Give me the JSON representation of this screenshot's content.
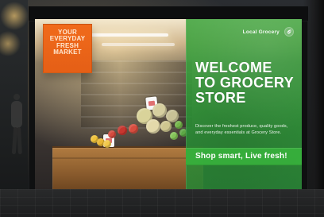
{
  "orange_poster": {
    "text": "YOUR\nEVERYDAY\nFRESH\nMARKET",
    "color": "#f06a1b"
  },
  "green_panel": {
    "brand": "Local Grocery",
    "headline": "WELCOME\nTO GROCERY\nSTORE",
    "subtext": "Discover the freshest produce, quality goods,\nand everyday essentials at Grocery Store.",
    "cta": "Shop smart, Live fresh!",
    "accent_color": "#3aa33f"
  }
}
